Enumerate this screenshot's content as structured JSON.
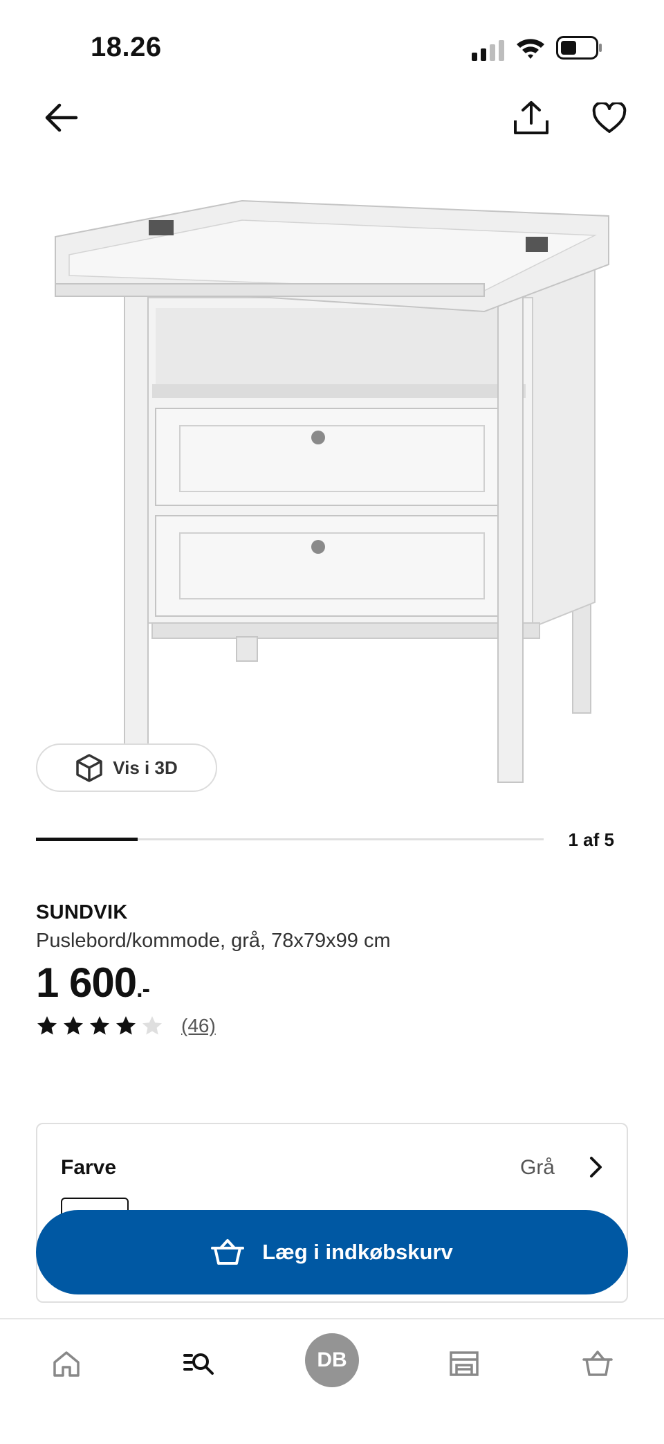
{
  "status_bar": {
    "time": "18.26"
  },
  "gallery": {
    "view_3d_label": "Vis i 3D",
    "position_label": "1 af 5",
    "progress": 0.2
  },
  "product": {
    "name": "SUNDVIK",
    "description": "Puslebord/kommode, grå, 78x79x99 cm",
    "price": "1 600",
    "price_suffix": ".-",
    "rating": 4,
    "rating_max": 5,
    "review_count": "(46)"
  },
  "color_option": {
    "title": "Farve",
    "value": "Grå"
  },
  "cart": {
    "button_label": "Læg i indkøbskurv",
    "brand_color": "#0058a3"
  },
  "tab_bar": {
    "items": [
      "home-icon",
      "search-list-icon",
      "profile-avatar",
      "store-icon",
      "basket-icon"
    ],
    "avatar_initials": "DB"
  }
}
